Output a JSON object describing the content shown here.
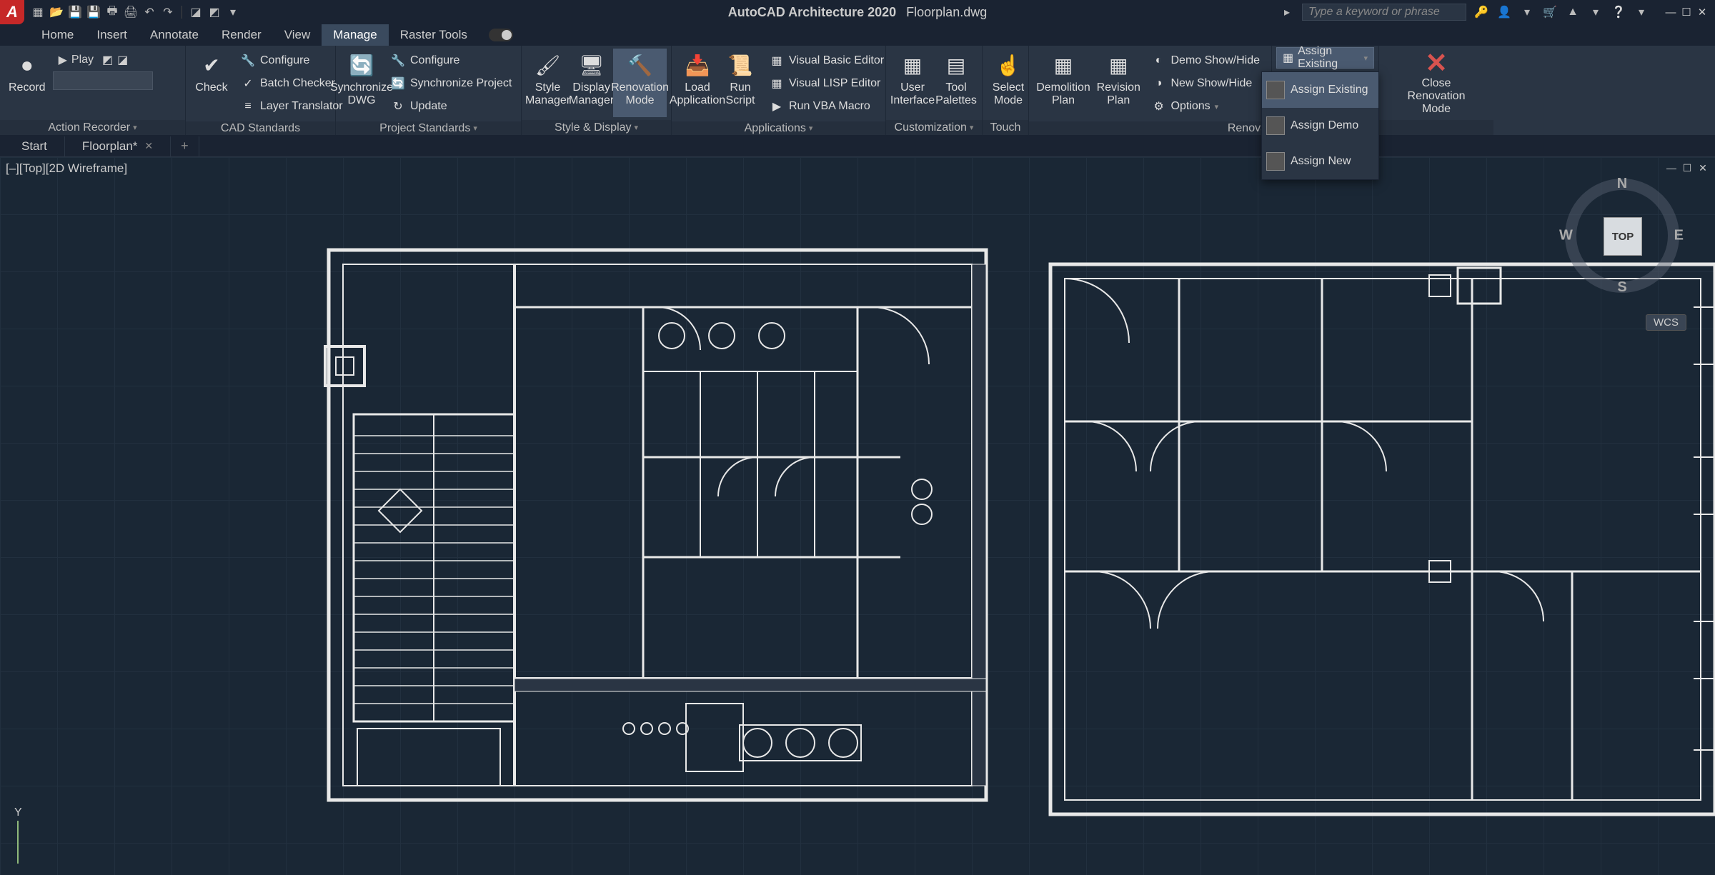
{
  "title": {
    "app": "AutoCAD Architecture 2020",
    "file": "Floorplan.dwg"
  },
  "search_placeholder": "Type a keyword or phrase",
  "menus": [
    "Home",
    "Insert",
    "Annotate",
    "Render",
    "View",
    "Manage",
    "Raster Tools"
  ],
  "active_menu": "Manage",
  "ribbon": {
    "action_recorder": {
      "record": "Record",
      "play": "Play",
      "title": "Action Recorder"
    },
    "cad_standards": {
      "configure": "Configure",
      "batch_checker": "Batch Checker",
      "layer_translator": "Layer Translator",
      "check": "Check",
      "title": "CAD Standards"
    },
    "project": {
      "sync_dwg": "Synchronize\nDWG",
      "configure": "Configure",
      "sync_project": "Synchronize Project",
      "update": "Update",
      "title": "Project Standards"
    },
    "style_display": {
      "style_mgr": "Style\nManager",
      "display_mgr": "Display\nManager",
      "renovation": "Renovation\nMode",
      "title": "Style & Display"
    },
    "applications": {
      "load": "Load\nApplication",
      "run_script": "Run\nScript",
      "vb_editor": "Visual Basic Editor",
      "vlisp_editor": "Visual LISP Editor",
      "vba_macro": "Run VBA Macro",
      "title": "Applications"
    },
    "customization": {
      "user_interface": "User\nInterface",
      "tool_palettes": "Tool\nPalettes",
      "title": "Customization"
    },
    "touch": {
      "select_mode": "Select\nMode",
      "title": "Touch"
    },
    "renovation_panel": {
      "demolition": "Demolition\nPlan",
      "revision": "Revision\nPlan",
      "demo_showhide": "Demo Show/Hide",
      "new_showhide": "New Show/Hide",
      "options": "Options",
      "assign_existing": "Assign Existing",
      "title": "Renova",
      "close": "Close\nRenovation Mode"
    }
  },
  "assign_dropdown": [
    "Assign Existing",
    "Assign Demo",
    "Assign New"
  ],
  "filetabs": {
    "start": "Start",
    "floorplan": "Floorplan*"
  },
  "view_label": "[–][Top][2D Wireframe]",
  "viewcube": {
    "top": "TOP",
    "n": "N",
    "s": "S",
    "e": "E",
    "w": "W"
  },
  "wcs": "WCS",
  "ucs_y": "Y"
}
